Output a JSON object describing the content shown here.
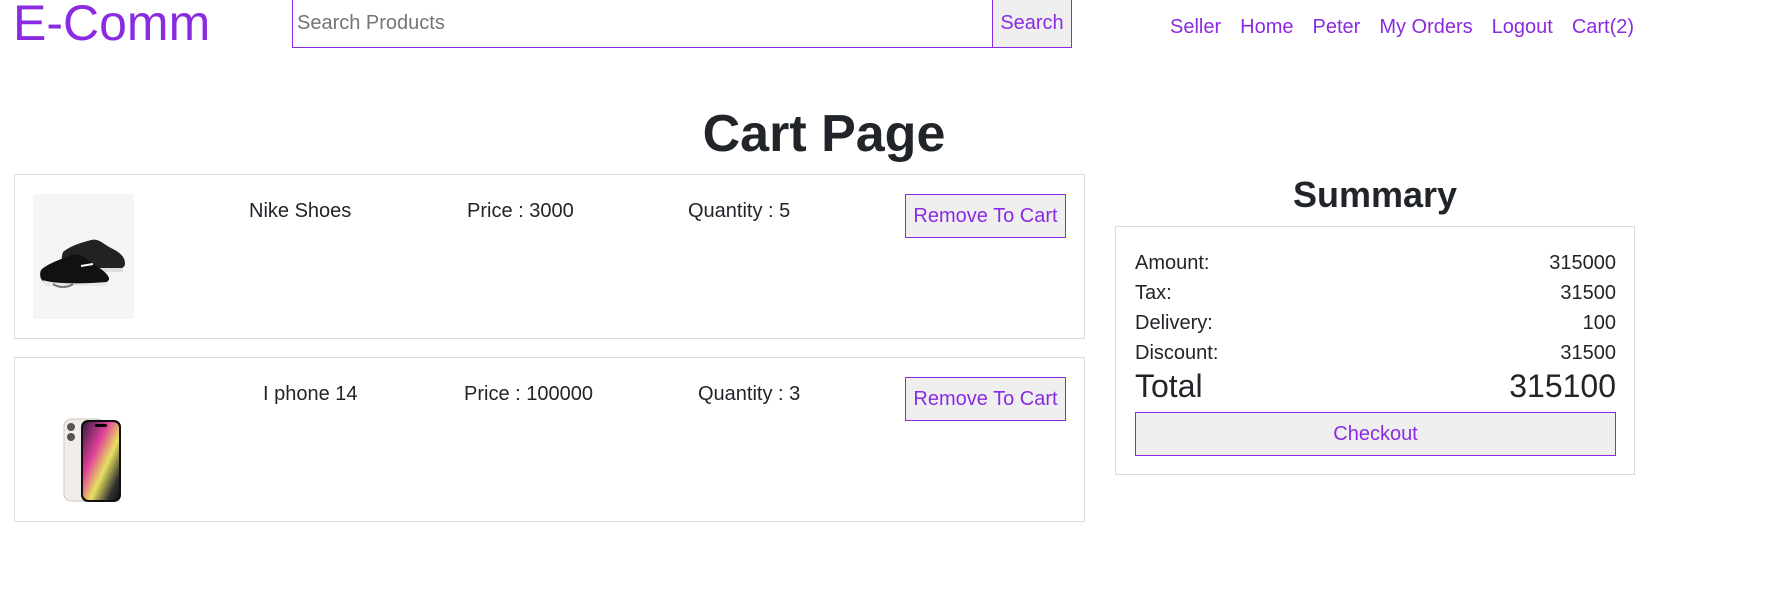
{
  "header": {
    "logo": "E-Comm",
    "search": {
      "placeholder": "Search Products",
      "value": "",
      "button_label": "Search"
    },
    "nav": [
      "Seller",
      "Home",
      "Peter",
      "My Orders",
      "Logout",
      "Cart(2)"
    ]
  },
  "page_title": "Cart Page",
  "cart_items": [
    {
      "name": "Nike Shoes",
      "price": "Price : 3000",
      "quantity": "Quantity : 5",
      "remove_label": "Remove To Cart",
      "image_icon": "sneaker-image"
    },
    {
      "name": "I phone 14",
      "price": "Price : 100000",
      "quantity": "Quantity : 3",
      "remove_label": "Remove To Cart",
      "image_icon": "phone-image"
    }
  ],
  "summary": {
    "title": "Summary",
    "amount_label": "Amount:",
    "amount": "315000",
    "tax_label": "Tax:",
    "tax": "31500",
    "delivery_label": "Delivery:",
    "delivery": "100",
    "discount_label": "Discount:",
    "discount": "31500",
    "total_label": "Total",
    "total": "315100",
    "checkout_label": "Checkout"
  },
  "colors": {
    "accent": "#8a2be2",
    "button_bg": "#efefef",
    "border": "#dcdcdc",
    "text": "#212529"
  }
}
